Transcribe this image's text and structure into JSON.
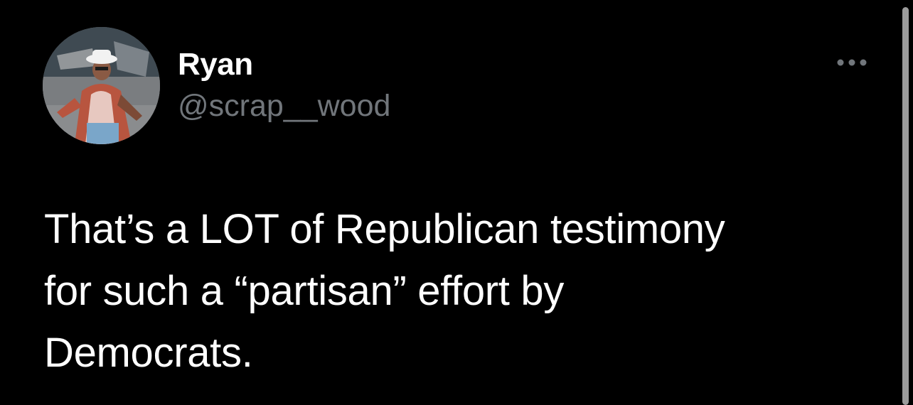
{
  "author": {
    "display_name": "Ryan",
    "handle": "@scrap__wood",
    "avatar": "user-avatar-photo"
  },
  "tweet": {
    "text": "That’s a LOT of Republican testimony\nfor such a “partisan” effort by\nDemocrats."
  },
  "actions": {
    "more_icon": "more-horizontal-icon"
  },
  "colors": {
    "background": "#000000",
    "primary_text": "#ffffff",
    "secondary_text": "#71767b"
  }
}
